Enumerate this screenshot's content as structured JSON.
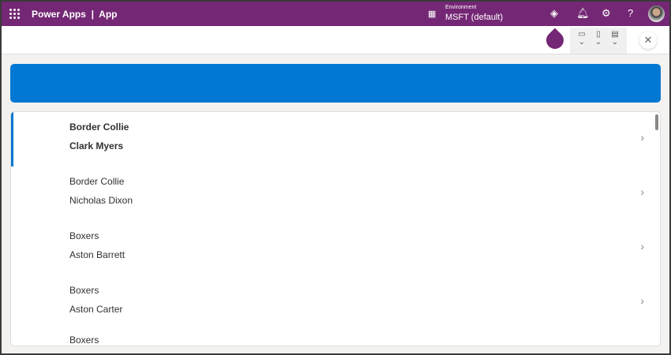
{
  "header": {
    "brand": "Power Apps  |  App",
    "environment_label": "Environment",
    "environment_value": "MSFT (default)"
  },
  "toolbar": {
    "close": "✕"
  },
  "items": [
    {
      "title": "Border Collie",
      "subtitle": "Clark Myers",
      "selected": true
    },
    {
      "title": "Border Collie",
      "subtitle": "Nicholas Dixon"
    },
    {
      "title": "Boxers",
      "subtitle": "Aston Barrett"
    },
    {
      "title": "Boxers",
      "subtitle": "Aston Carter"
    },
    {
      "title": "Boxers",
      "subtitle": ""
    }
  ],
  "colors": {
    "brand": "#742774",
    "accent": "#0078d4"
  }
}
